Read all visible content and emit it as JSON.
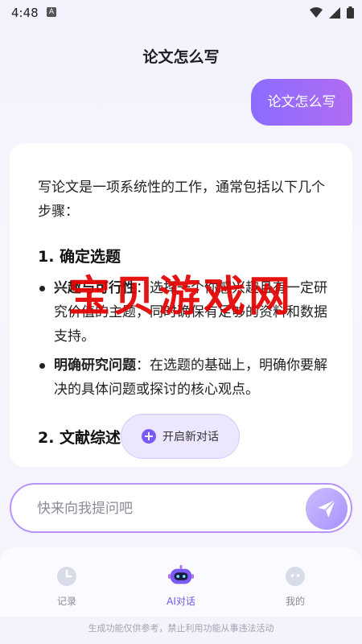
{
  "status_bar": {
    "time": "4:48",
    "notif_letter": "A"
  },
  "header": {
    "title": "论文怎么写"
  },
  "chat": {
    "user_message": "论文怎么写",
    "answer": {
      "intro": "写论文是一项系统性的工作，通常包括以下几个步骤：",
      "section1_title": "1. 确定选题",
      "bullets": [
        {
          "bold": "兴趣与可行性",
          "text": "：选择一个你感兴趣且有一定研究价值的主题，同时确保有足够的资料和数据支持。"
        },
        {
          "bold": "明确研究问题",
          "text": "：在选题的基础上，明确你要解决的具体问题或探讨的核心观点。"
        }
      ],
      "section2_title": "2. 文献综述"
    }
  },
  "watermark": "宝贝游戏网",
  "new_chat_button": {
    "label": "开启新对话"
  },
  "input": {
    "placeholder": "快来向我提问吧"
  },
  "nav": {
    "items": [
      {
        "label": "记录",
        "icon": "clock-icon"
      },
      {
        "label": "AI对话",
        "icon": "robot-icon"
      },
      {
        "label": "我的",
        "icon": "profile-icon"
      }
    ]
  },
  "footer": {
    "note": "生成功能仅供参考，禁止利用功能从事违法活动"
  },
  "colors": {
    "accent": "#7b5bf5",
    "bubble_start": "#8a6cff",
    "bubble_end": "#b06cf2"
  }
}
